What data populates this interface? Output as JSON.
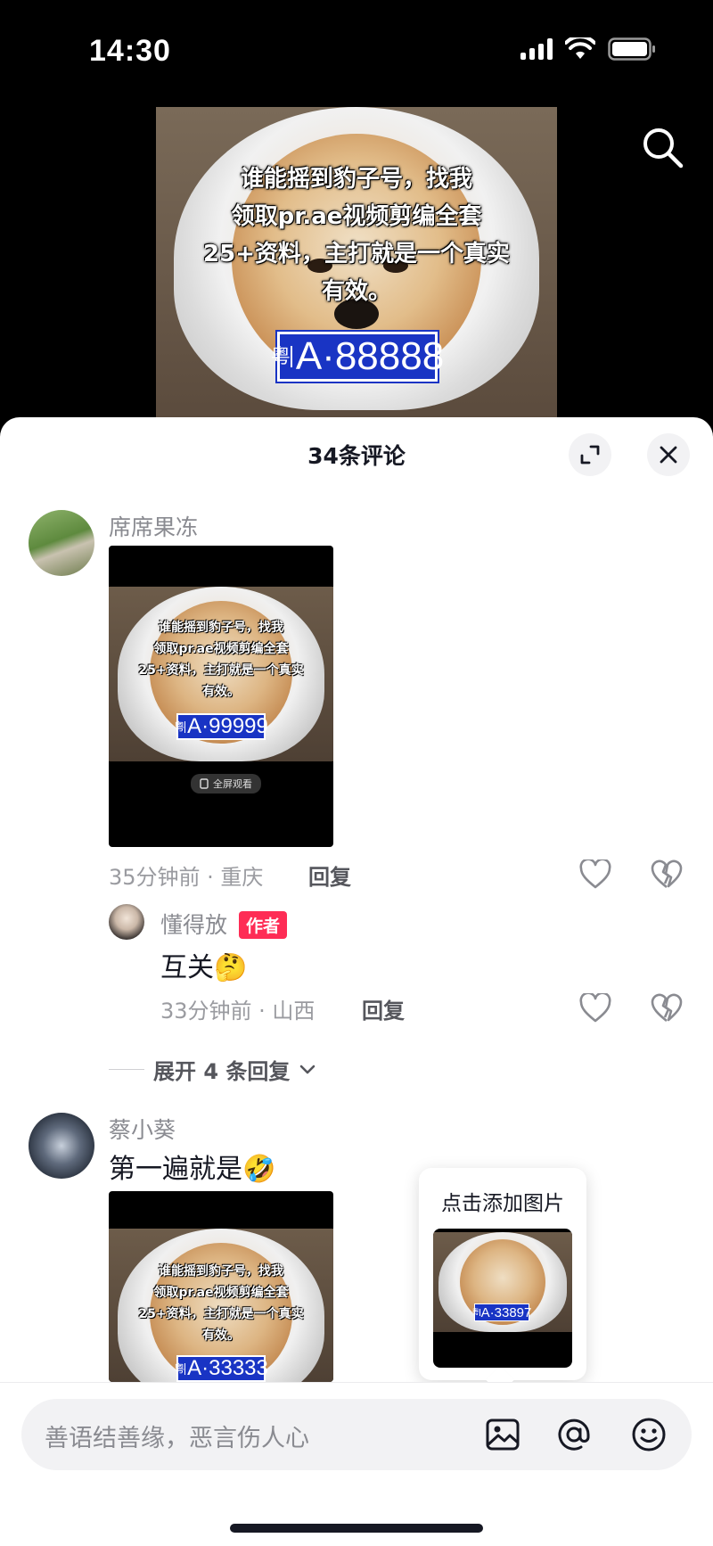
{
  "status_bar": {
    "time": "14:30"
  },
  "video": {
    "overlay_text": "谁能摇到豹子号，找我\n领取pr.ae视频剪编全套\n25+资料，主打就是一个真实\n有效。",
    "plate_province": "粤",
    "plate_number": "A·88888"
  },
  "sheet": {
    "title": "34条评论"
  },
  "comments": [
    {
      "username": "席席果冻",
      "text": "",
      "image": {
        "overlay_text": "谁能摇到豹子号，找我\n领取pr.ae视频剪编全套\n25+资料，主打就是一个真实\n有效。",
        "plate_province": "粤",
        "plate_number": "A·99999",
        "fullscreen_label": "全屏观看"
      },
      "meta": "35分钟前 · 重庆",
      "reply_label": "回复",
      "replies": [
        {
          "username": "懂得放",
          "badge": "作者",
          "text": "互关",
          "emoji": "🤔",
          "meta": "33分钟前 · 山西",
          "reply_label": "回复"
        }
      ],
      "expand_label": "展开 4 条回复"
    },
    {
      "username": "蔡小葵",
      "text": "第一遍就是",
      "emoji": "🤣",
      "image": {
        "overlay_text": "谁能摇到豹子号，找我\n领取pr.ae视频剪编全套\n25+资料，主打就是一个真实\n有效。",
        "plate_province": "粤",
        "plate_number": "A·33333"
      }
    }
  ],
  "popup": {
    "title": "点击添加图片",
    "preview_plate_province": "粤",
    "preview_plate_number": "A·33897"
  },
  "input": {
    "placeholder": "善语结善缘，恶言伤人心"
  },
  "colors": {
    "accent_red": "#fe2c55",
    "plate_blue": "#1934c4",
    "text_primary": "#161823",
    "text_secondary": "#8a8b91"
  },
  "icons": [
    "search-icon",
    "expand-icon",
    "close-icon",
    "heart-icon",
    "dislike-icon",
    "image-icon",
    "at-icon",
    "emoji-icon",
    "chevron-down-icon"
  ]
}
